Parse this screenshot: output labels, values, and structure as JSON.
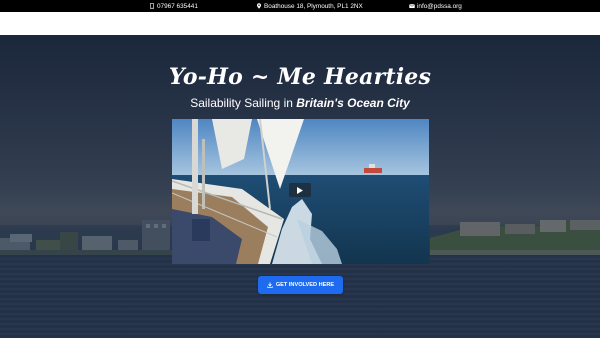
{
  "topbar": {
    "phone": "07967 635441",
    "address": "Boathouse 18, Plymouth, PL1 2NX",
    "email": "info@pdssa.org",
    "icons": [
      "phone-icon",
      "map-marker-icon",
      "envelope-icon"
    ]
  },
  "hero": {
    "headline": "Yo-Ho ~ Me Hearties",
    "subheadline_prefix": "Sailability Sailing in ",
    "subheadline_emphasis": "Britain's Ocean City",
    "cta_label": "GET INVOLVED HERE",
    "cta_icon": "download-icon",
    "video_icon": "play-icon"
  },
  "colors": {
    "topbar_bg": "#000000",
    "cta_bg": "#1f6bf0",
    "text": "#ffffff"
  }
}
